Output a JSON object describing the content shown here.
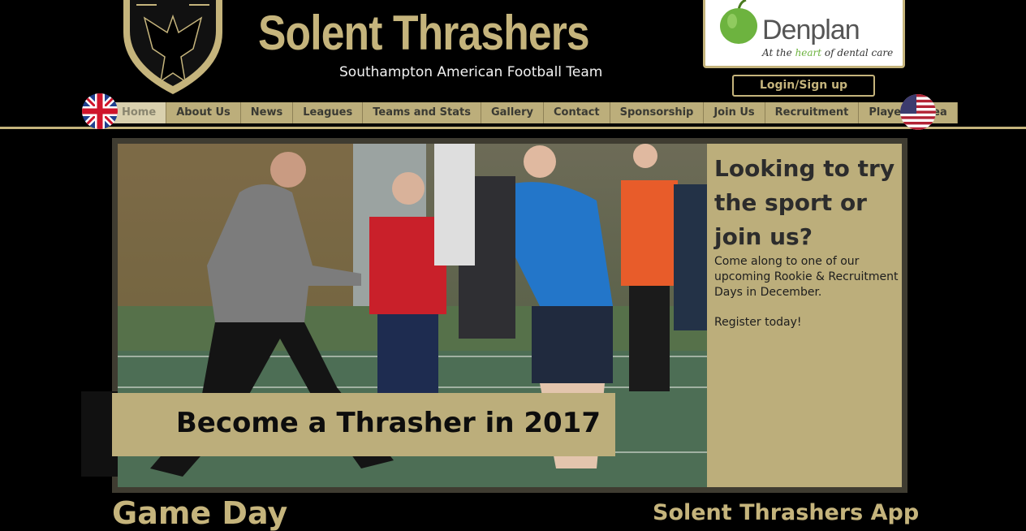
{
  "header": {
    "logo_icon": "thrasher-bird-shield-logo",
    "title": "Solent Thrashers",
    "subtitle": "Southampton American Football Team"
  },
  "sponsor": {
    "name": "Denplan",
    "tagline_pre": "At the ",
    "tagline_hl": "heart",
    "tagline_post": " of dental care",
    "icon": "green-apple-icon"
  },
  "login": {
    "label": "Login/Sign up"
  },
  "nav": {
    "items": [
      {
        "label": "Home",
        "active": true
      },
      {
        "label": "About Us"
      },
      {
        "label": "News"
      },
      {
        "label": "Leagues"
      },
      {
        "label": "Teams and Stats"
      },
      {
        "label": "Gallery"
      },
      {
        "label": "Contact"
      },
      {
        "label": "Sponsorship"
      },
      {
        "label": "Join Us"
      },
      {
        "label": "Recruitment"
      },
      {
        "label": "Players' Area"
      }
    ]
  },
  "flags": {
    "left": "uk-flag-icon",
    "right": "us-flag-icon"
  },
  "hero": {
    "banner": "Become a Thrasher in 2017",
    "promo_title": "Looking to try the sport or join us?",
    "promo_body": "Come along to one of our upcoming Rookie & Recruitment Days in December.",
    "promo_cta": "Register today!"
  },
  "sections": {
    "game_day": "Game Day",
    "app": "Solent Thrashers App"
  },
  "colors": {
    "gold": "#c5b47c",
    "nav_bg": "#bcae7b",
    "background": "#000000"
  }
}
